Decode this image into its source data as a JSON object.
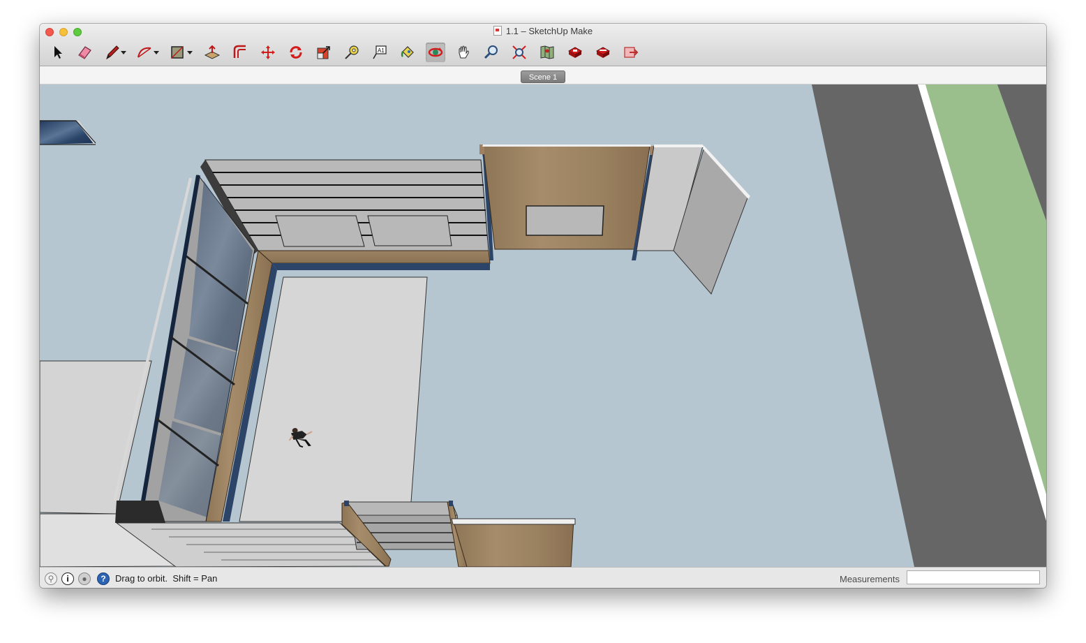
{
  "window": {
    "title": "1.1 – SketchUp Make"
  },
  "toolbar": {
    "tools": [
      {
        "name": "select-tool",
        "icon": "arrow-cursor-icon",
        "tooltip": "Select"
      },
      {
        "name": "eraser-tool",
        "icon": "eraser-icon",
        "tooltip": "Eraser"
      },
      {
        "name": "line-tool",
        "icon": "pencil-icon",
        "tooltip": "Line",
        "has_dropdown": true
      },
      {
        "name": "arc-tool",
        "icon": "arc-icon",
        "tooltip": "Arc",
        "has_dropdown": true
      },
      {
        "name": "shapes-tool",
        "icon": "rectangle-icon",
        "tooltip": "Shapes",
        "has_dropdown": true
      },
      {
        "name": "push-pull-tool",
        "icon": "push-pull-icon",
        "tooltip": "Push/Pull"
      },
      {
        "name": "offset-tool",
        "icon": "offset-icon",
        "tooltip": "Offset"
      },
      {
        "name": "move-tool",
        "icon": "move-icon",
        "tooltip": "Move"
      },
      {
        "name": "rotate-tool",
        "icon": "rotate-icon",
        "tooltip": "Rotate"
      },
      {
        "name": "scale-tool",
        "icon": "scale-icon",
        "tooltip": "Scale"
      },
      {
        "name": "tape-measure-tool",
        "icon": "tape-measure-icon",
        "tooltip": "Tape Measure"
      },
      {
        "name": "text-tool",
        "icon": "text-icon",
        "tooltip": "Text"
      },
      {
        "name": "paint-bucket-tool",
        "icon": "paint-bucket-icon",
        "tooltip": "Paint Bucket"
      },
      {
        "name": "orbit-tool",
        "icon": "orbit-icon",
        "tooltip": "Orbit",
        "selected": true
      },
      {
        "name": "pan-tool",
        "icon": "hand-icon",
        "tooltip": "Pan"
      },
      {
        "name": "zoom-tool",
        "icon": "magnifier-icon",
        "tooltip": "Zoom"
      },
      {
        "name": "zoom-extents-tool",
        "icon": "zoom-extents-icon",
        "tooltip": "Zoom Extents"
      },
      {
        "name": "add-location-tool",
        "icon": "map-icon",
        "tooltip": "Add Location"
      },
      {
        "name": "3d-warehouse-tool",
        "icon": "warehouse-icon",
        "tooltip": "3D Warehouse"
      },
      {
        "name": "extension-warehouse-tool",
        "icon": "extension-warehouse-icon",
        "tooltip": "Extension Warehouse"
      },
      {
        "name": "share-model-tool",
        "icon": "share-icon",
        "tooltip": "Share Model"
      }
    ]
  },
  "scenes": {
    "tabs": [
      "Scene 1"
    ]
  },
  "statusbar": {
    "icons": [
      "geo-location-icon",
      "info-icon",
      "user-icon",
      "help-icon"
    ],
    "hint": "Drag to orbit.  Shift = Pan",
    "measurements_label": "Measurements",
    "measurements_value": ""
  },
  "colors": {
    "sky": "#b5c6d0",
    "road": "#666666",
    "grass": "#9abf8c",
    "wood": "#a68c68",
    "glass": "#34507a",
    "wall": "#b0b0b0"
  }
}
